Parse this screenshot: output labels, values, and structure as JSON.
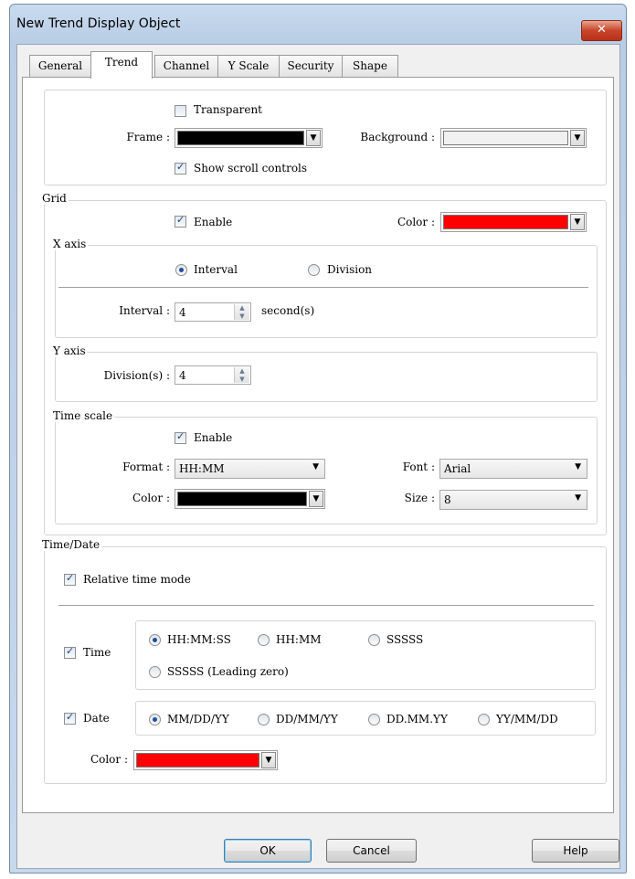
{
  "window": {
    "title": "New Trend Display Object",
    "close_icon": "close-icon"
  },
  "tabs": [
    "General",
    "Trend",
    "Channel",
    "Y Scale",
    "Security",
    "Shape"
  ],
  "selected_tab": "Trend",
  "appearance": {
    "transparent_label": "Transparent",
    "transparent_checked": false,
    "frame_label": "Frame :",
    "frame_color": "#000000",
    "background_label": "Background :",
    "background_color": "#f0f0f0",
    "show_scroll_label": "Show scroll controls",
    "show_scroll_checked": true
  },
  "grid": {
    "title": "Grid",
    "enable_label": "Enable",
    "enable_checked": true,
    "color_label": "Color :",
    "color": "#ff0000",
    "x_axis": {
      "title": "X axis",
      "interval_radio": "Interval",
      "division_radio": "Division",
      "selected": "Interval",
      "interval_label": "Interval :",
      "interval_value": "4",
      "unit": "second(s)"
    },
    "y_axis": {
      "title": "Y axis",
      "division_label": "Division(s) :",
      "division_value": "4"
    },
    "time_scale": {
      "title": "Time scale",
      "enable_label": "Enable",
      "enable_checked": true,
      "format_label": "Format :",
      "format_value": "HH:MM",
      "font_label": "Font :",
      "font_value": "Arial",
      "color_label": "Color :",
      "color": "#000000",
      "size_label": "Size :",
      "size_value": "8"
    }
  },
  "time_date": {
    "title": "Time/Date",
    "relative_label": "Relative time mode",
    "relative_checked": true,
    "time_label": "Time",
    "time_checked": true,
    "time_options": [
      "HH:MM:SS",
      "HH:MM",
      "SSSSS",
      "SSSSS (Leading zero)"
    ],
    "time_selected": "HH:MM:SS",
    "date_label": "Date",
    "date_checked": true,
    "date_options": [
      "MM/DD/YY",
      "DD/MM/YY",
      "DD.MM.YY",
      "YY/MM/DD"
    ],
    "date_selected": "MM/DD/YY",
    "color_label": "Color :",
    "color": "#ff0000"
  },
  "buttons": {
    "ok": "OK",
    "cancel": "Cancel",
    "help": "Help"
  }
}
